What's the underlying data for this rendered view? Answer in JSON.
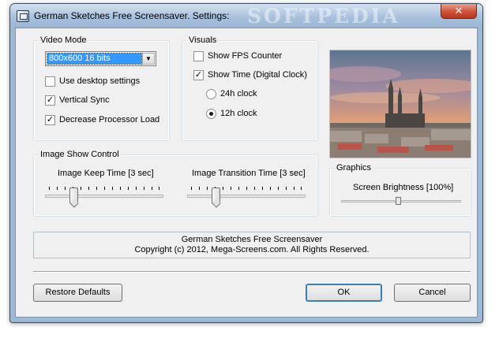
{
  "window": {
    "title": "German Sketches Free Screensaver. Settings:",
    "watermark": "SOFTPEDIA",
    "close_label": "✕"
  },
  "video_mode": {
    "label": "Video Mode",
    "resolution": "800x600 16 bits",
    "use_desktop_label": "Use desktop settings",
    "use_desktop_checked": false,
    "vsync_label": "Vertical Sync",
    "vsync_checked": true,
    "decrease_load_label": "Decrease Processor Load",
    "decrease_load_checked": true
  },
  "visuals": {
    "label": "Visuals",
    "fps_label": "Show FPS Counter",
    "fps_checked": false,
    "time_label": "Show Time (Digital Clock)",
    "time_checked": true,
    "clock_24_label": "24h clock",
    "clock_12_label": "12h clock",
    "selected_clock": "12h"
  },
  "image_show": {
    "label": "Image Show Control",
    "keep_time_label": "Image Keep Time [3 sec]",
    "keep_time_value": 3,
    "transition_label": "Image Transition Time [3 sec]",
    "transition_value": 3
  },
  "graphics": {
    "label": "Graphics",
    "brightness_label": "Screen Brightness [100%]",
    "brightness_value": 100
  },
  "info": {
    "line1": "German Sketches Free Screensaver",
    "line2": "Copyright (c) 2012, Mega-Screens.com. All Rights Reserved."
  },
  "buttons": {
    "restore": "Restore Defaults",
    "ok": "OK",
    "cancel": "Cancel"
  },
  "colors": {
    "titlebar": "#a9c1dc",
    "selection": "#3399ff",
    "close": "#d0573c"
  }
}
